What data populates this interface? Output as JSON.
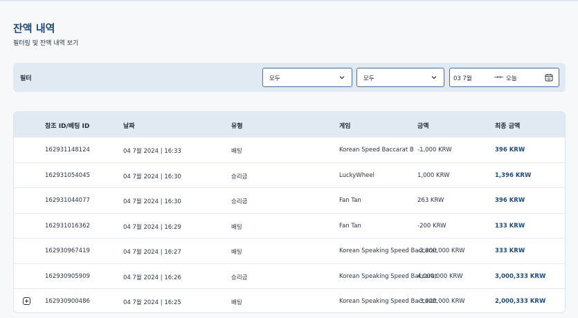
{
  "header": {
    "title": "잔액 내역",
    "subtitle": "필터링 및 잔액 내역 보기"
  },
  "filter": {
    "label": "필터",
    "select1_value": "모두",
    "select2_value": "모두",
    "date_from": "03 7월",
    "date_arrow": "→←",
    "date_to": "오늘"
  },
  "table": {
    "columns": [
      "참조 ID/베팅 ID",
      "날짜",
      "유형",
      "게임",
      "금액",
      "최종 금액"
    ],
    "rows": [
      {
        "ref": "162931148124",
        "date": "04 7월 2024 | 16:33",
        "type": "배팅",
        "game": "Korean Speed Baccarat B",
        "amount": "-1,000 KRW",
        "final": "396 KRW"
      },
      {
        "ref": "162931054045",
        "date": "04 7월 2024 | 16:30",
        "type": "승리금",
        "game": "LuckyWheel",
        "amount": "1,000 KRW",
        "final": "1,396 KRW"
      },
      {
        "ref": "162931044077",
        "date": "04 7월 2024 | 16:30",
        "type": "승리금",
        "game": "Fan Tan",
        "amount": "263 KRW",
        "final": "396 KRW"
      },
      {
        "ref": "162931016362",
        "date": "04 7월 2024 | 16:29",
        "type": "배팅",
        "game": "Fan Tan",
        "amount": "-200 KRW",
        "final": "133 KRW"
      },
      {
        "ref": "162930967419",
        "date": "04 7월 2024 | 16:27",
        "type": "배팅",
        "game": "Korean Speaking Speed Baccarat",
        "amount": "-2,000,000 KRW",
        "final": "333 KRW"
      },
      {
        "ref": "162930905909",
        "date": "04 7월 2024 | 16:26",
        "type": "승리금",
        "game": "Korean Speaking Speed Baccarat",
        "amount": "4,000,000 KRW",
        "final": "3,000,333 KRW"
      },
      {
        "ref": "162930900486",
        "date": "04 7월 2024 | 16:25",
        "type": "배팅",
        "game": "Korean Speaking Speed Baccarat",
        "amount": "-3,025,000 KRW",
        "final": "2,000,333 KRW"
      }
    ]
  },
  "colors": {
    "accent": "#1e4a7a",
    "filter_bg": "#e1e9f3",
    "border": "#4a6e95"
  },
  "icons": [
    "chevron-down-icon",
    "calendar-icon",
    "expand-plus-icon"
  ]
}
